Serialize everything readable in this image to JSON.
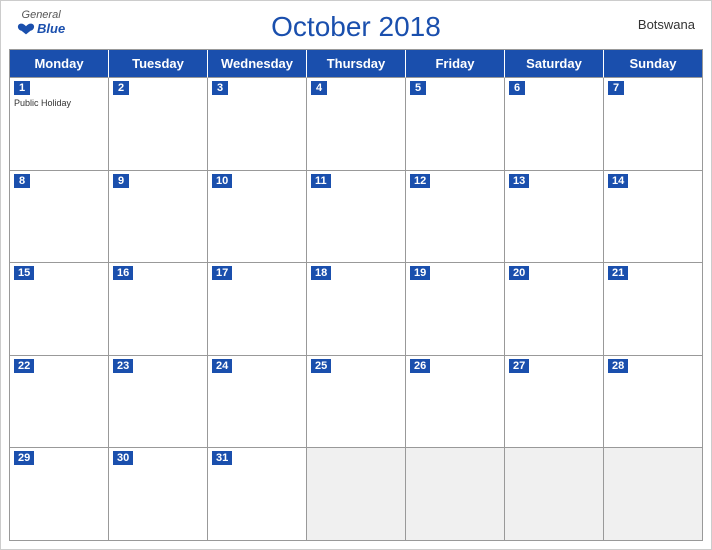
{
  "header": {
    "logo": {
      "general": "General",
      "blue": "Blue"
    },
    "title": "October 2018",
    "country": "Botswana"
  },
  "days_of_week": [
    "Monday",
    "Tuesday",
    "Wednesday",
    "Thursday",
    "Friday",
    "Saturday",
    "Sunday"
  ],
  "weeks": [
    [
      {
        "day": 1,
        "event": "Public Holiday"
      },
      {
        "day": 2
      },
      {
        "day": 3
      },
      {
        "day": 4
      },
      {
        "day": 5
      },
      {
        "day": 6
      },
      {
        "day": 7
      }
    ],
    [
      {
        "day": 8
      },
      {
        "day": 9
      },
      {
        "day": 10
      },
      {
        "day": 11
      },
      {
        "day": 12
      },
      {
        "day": 13
      },
      {
        "day": 14
      }
    ],
    [
      {
        "day": 15
      },
      {
        "day": 16
      },
      {
        "day": 17
      },
      {
        "day": 18
      },
      {
        "day": 19
      },
      {
        "day": 20
      },
      {
        "day": 21
      }
    ],
    [
      {
        "day": 22
      },
      {
        "day": 23
      },
      {
        "day": 24
      },
      {
        "day": 25
      },
      {
        "day": 26
      },
      {
        "day": 27
      },
      {
        "day": 28
      }
    ],
    [
      {
        "day": 29
      },
      {
        "day": 30
      },
      {
        "day": 31
      },
      {
        "day": null
      },
      {
        "day": null
      },
      {
        "day": null
      },
      {
        "day": null
      }
    ]
  ]
}
